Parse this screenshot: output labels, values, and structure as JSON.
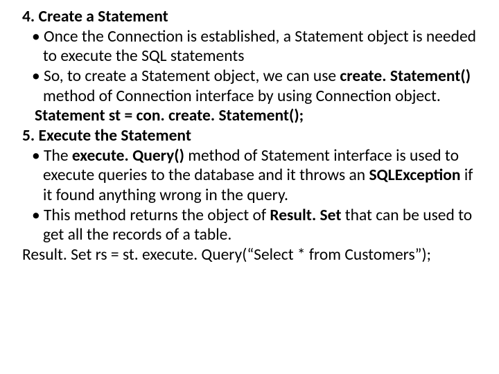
{
  "h4": "4. Create a Statement",
  "b4_1a": "Once the Connection is established, a Statement object is needed to execute the  SQL statements",
  "b4_2a": " So, to create a Statement object, we can use ",
  "b4_2b": "create. Statement()",
  "b4_2c": " method of Connection interface by using Connection object.",
  "code4": " Statement st = con. create. Statement();",
  "h5": "5. Execute the Statement",
  "b5_1a": "The ",
  "b5_1b": "execute. Query()",
  "b5_1c": " method of Statement interface is used to execute queries to the database and it throws an ",
  "b5_1d": "SQLException",
  "b5_1e": " if it found anything wrong in the query.",
  "b5_2a": "This method returns the object of ",
  "b5_2b": "Result. Set",
  "b5_2c": " that can be used to get all the records of a table.",
  "code5": "Result. Set  rs  =  st. execute. Query(“Select * from Customers”);"
}
